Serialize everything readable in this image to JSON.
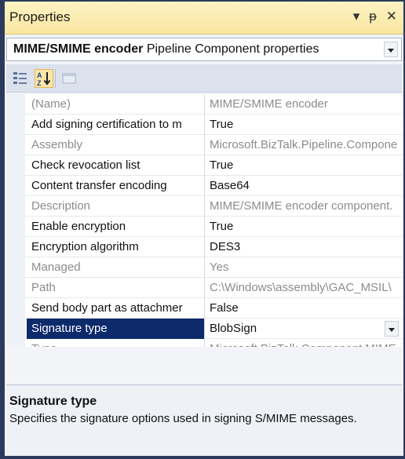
{
  "window": {
    "title": "Properties",
    "dropdown_icon": "caret-down-icon",
    "pin_icon": "pin-icon",
    "close_icon": "close-icon"
  },
  "selector": {
    "object_name": "MIME/SMIME encoder",
    "object_type": "Pipeline Component properties"
  },
  "toolbar": {
    "buttons": [
      {
        "name": "categorized-icon",
        "active": false
      },
      {
        "name": "alphabetical-icon",
        "active": true
      },
      {
        "name": "property-pages-icon",
        "active": false,
        "enabled": false
      }
    ]
  },
  "properties": [
    {
      "name": "(Name)",
      "value": "MIME/SMIME encoder",
      "readonly": true
    },
    {
      "name": "Add signing certification to m",
      "value": "True",
      "readonly": false
    },
    {
      "name": "Assembly",
      "value": "Microsoft.BizTalk.Pipeline.Compone",
      "readonly": true
    },
    {
      "name": "Check revocation list",
      "value": "True",
      "readonly": false
    },
    {
      "name": "Content transfer encoding",
      "value": "Base64",
      "readonly": false
    },
    {
      "name": "Description",
      "value": "MIME/SMIME encoder component.",
      "readonly": true
    },
    {
      "name": "Enable encryption",
      "value": "True",
      "readonly": false
    },
    {
      "name": "Encryption algorithm",
      "value": "DES3",
      "readonly": false
    },
    {
      "name": "Managed",
      "value": "Yes",
      "readonly": true
    },
    {
      "name": "Path",
      "value": "C:\\Windows\\assembly\\GAC_MSIL\\",
      "readonly": true
    },
    {
      "name": "Send body part as attachmer",
      "value": "False",
      "readonly": false
    },
    {
      "name": "Signature type",
      "value": "BlobSign",
      "readonly": false,
      "selected": true
    },
    {
      "name": "Type",
      "value": "Microsoft.BizTalk.Component.MIME",
      "readonly": true
    }
  ],
  "description": {
    "title": "Signature type",
    "text": "Specifies the signature options used in signing S/MIME messages."
  },
  "colors": {
    "titlebar": "#f9e6a0",
    "selection": "#0d2a6b",
    "readonly_text": "#8c8c8c"
  }
}
